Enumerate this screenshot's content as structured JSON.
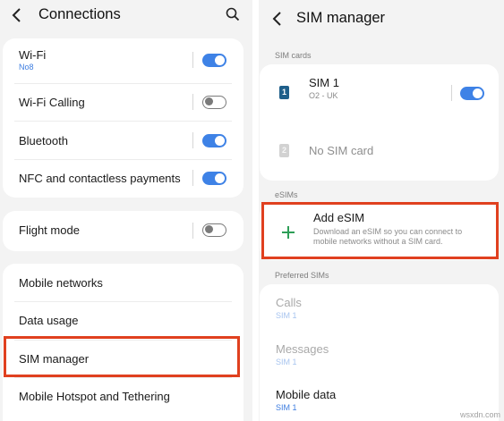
{
  "left": {
    "title": "Connections",
    "group1": [
      {
        "label": "Wi-Fi",
        "sub": "No8",
        "toggle": "on"
      },
      {
        "label": "Wi-Fi Calling",
        "toggle": "off"
      },
      {
        "label": "Bluetooth",
        "toggle": "on"
      },
      {
        "label": "NFC and contactless payments",
        "toggle": "on"
      }
    ],
    "flight_mode": {
      "label": "Flight mode",
      "toggle": "off"
    },
    "group3": [
      {
        "label": "Mobile networks"
      },
      {
        "label": "Data usage"
      },
      {
        "label": "SIM manager",
        "highlighted": true
      },
      {
        "label": "Mobile Hotspot and Tethering"
      }
    ]
  },
  "right": {
    "title": "SIM manager",
    "sim_cards_label": "SIM cards",
    "sim1": {
      "badge": "1",
      "name": "SIM 1",
      "carrier": "O2 - UK",
      "toggle": "on"
    },
    "sim2": {
      "badge": "2",
      "name": "No SIM card"
    },
    "esims_label": "eSIMs",
    "add_esim": {
      "title": "Add eSIM",
      "description": "Download an eSIM so you can connect to mobile networks without a SIM card."
    },
    "preferred_label": "Preferred SIMs",
    "preferred": [
      {
        "label": "Calls",
        "value": "SIM 1"
      },
      {
        "label": "Messages",
        "value": "SIM 1"
      },
      {
        "label": "Mobile data",
        "value": "SIM 1"
      }
    ]
  },
  "watermark": "wsxdn.com",
  "colors": {
    "accent": "#3e82e6",
    "highlight": "#e0401f",
    "add": "#2e9e57"
  }
}
